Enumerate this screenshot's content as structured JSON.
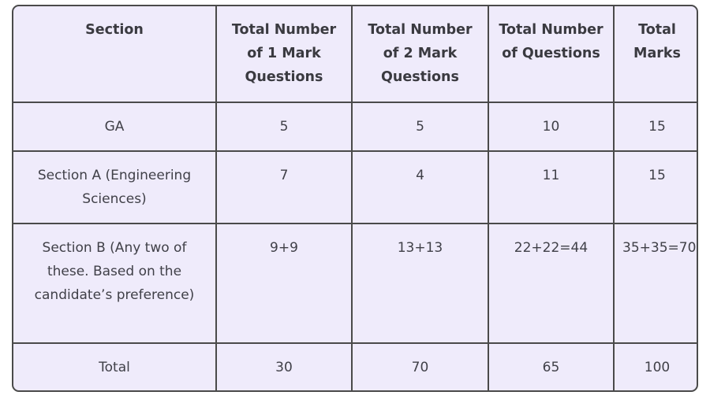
{
  "table": {
    "headers": [
      "Section",
      "Total Number of 1 Mark Questions",
      "Total Number of 2 Mark Questions",
      "Total Number of Questions",
      "Total Marks"
    ],
    "rows": [
      [
        "GA",
        "5",
        "5",
        "10",
        "15"
      ],
      [
        "Section A (Engineering Sciences)",
        "7",
        "4",
        "11",
        "15"
      ],
      [
        "Section B (Any two of these. Based on the candidate’s preference)",
        "9+9",
        "13+13",
        "22+22=44",
        "35+35=70"
      ],
      [
        "Total",
        "30",
        "70",
        "65",
        "100"
      ]
    ]
  },
  "colors": {
    "table_background": "#efebfb",
    "border": "#4a4a4a",
    "text": "#404048"
  }
}
